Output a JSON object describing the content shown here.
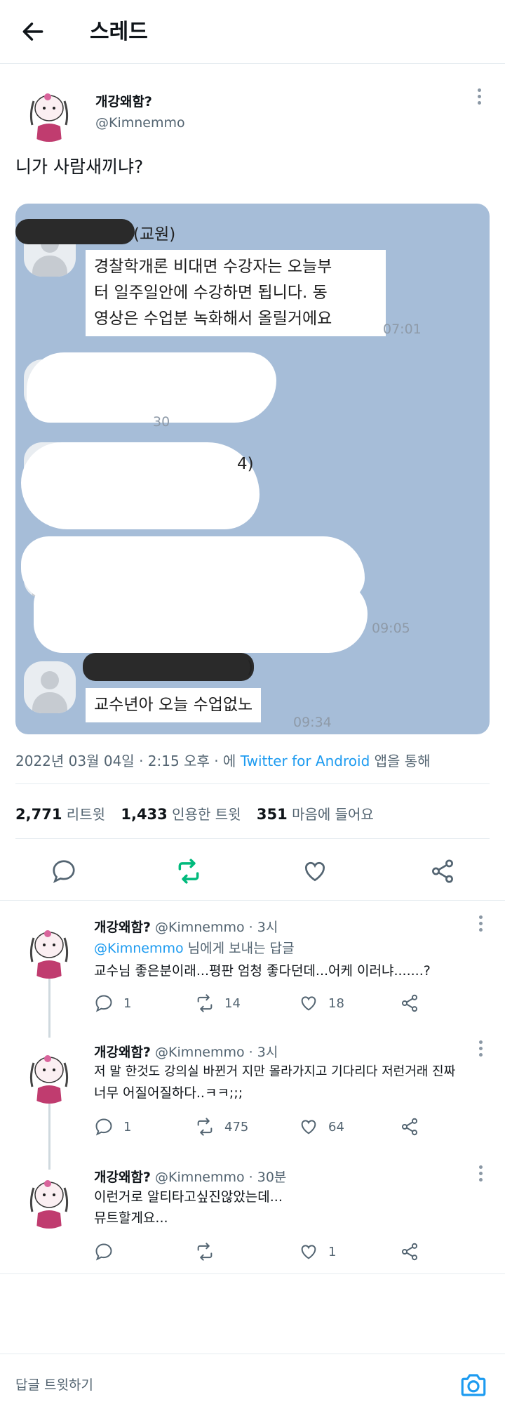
{
  "header": {
    "title": "스레드"
  },
  "tweet": {
    "author_name": "개강왜함?",
    "handle": "@Kimnemmo",
    "text": "니가 사람새끼냐?",
    "image": {
      "redacted_name_suffix_1": "(교원)",
      "message_1_line1": "경찰학개론 비대면 수강자는 오늘부",
      "message_1_line2": "터 일주일안에 수강하면 됩니다. 동",
      "message_1_line3": "영상은 수업분 녹화해서 올릴거에요",
      "time_1": "07:01",
      "time_2": "30",
      "partial_paren_2": "4)",
      "time_3": "09:05",
      "partial_paren_4": ")",
      "message_4": "교수년아 오늘 수업없노",
      "time_4": "09:34"
    },
    "meta": {
      "date": "2022년 03월 04일 · 2:15 오후 · 에",
      "source": "Twitter for Android",
      "suffix": "앱을 통해"
    },
    "stats": {
      "retweets": "2,771",
      "retweets_label": "리트윗",
      "quotes": "1,433",
      "quotes_label": "인용한 트윗",
      "likes": "351",
      "likes_label": "마음에 들어요"
    }
  },
  "replies": [
    {
      "name": "개강왜함?",
      "handle": "@Kimnemmo · 3시",
      "replying_to": "@Kimnemmo",
      "replying_suffix": "님에게 보내는 답글",
      "text_line1": "교수님 좋은분이래...평판 엄청 좋다던데...어케 이러냐.......?",
      "text_line2": "",
      "replies": "1",
      "retweets": "14",
      "likes": "18"
    },
    {
      "name": "개강왜함?",
      "handle": "@Kimnemmo · 3시",
      "text_line1": "저 말 한것도 강의실 바뀐거 지만 몰라가지고 기다리다 저런거래 진짜",
      "text_line2": "너무 어질어질하다..ㅋㅋ;;;",
      "replies": "1",
      "retweets": "475",
      "likes": "64"
    },
    {
      "name": "개강왜함?",
      "handle": "@Kimnemmo · 30분",
      "text_line1": "이런거로 알티타고싶진않았는데...",
      "text_line2": "뮤트할게요...",
      "replies": "",
      "retweets": "",
      "likes": "1"
    }
  ],
  "compose": {
    "placeholder": "답글 트윗하기"
  },
  "colors": {
    "accent": "#1d9bf0",
    "retweet_green": "#00ba7c",
    "photo_bg": "#a6bdd8"
  }
}
